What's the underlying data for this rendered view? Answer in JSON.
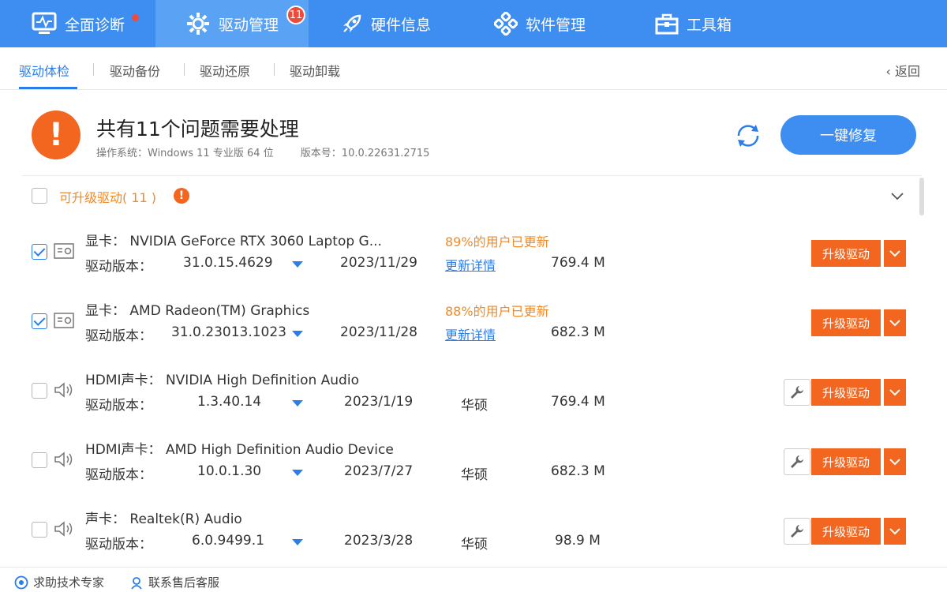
{
  "topnav": {
    "tabs": [
      {
        "label": "全面诊断",
        "icon": "monitor-pulse-icon"
      },
      {
        "label": "驱动管理",
        "icon": "gear-icon",
        "badge": "11"
      },
      {
        "label": "硬件信息",
        "icon": "rocket-icon"
      },
      {
        "label": "软件管理",
        "icon": "app-grid-icon"
      },
      {
        "label": "工具箱",
        "icon": "toolbox-icon"
      }
    ]
  },
  "subnav": {
    "tabs": [
      "驱动体检",
      "驱动备份",
      "驱动还原",
      "驱动卸载"
    ],
    "back": "返回"
  },
  "summary": {
    "title": "共有11个问题需要处理",
    "os": "操作系统：Windows 11 专业版 64 位",
    "version": "版本号：10.0.22631.2715",
    "fix_label": "一键修复"
  },
  "group": {
    "title": "可升级驱动( 11 )"
  },
  "rows": [
    {
      "name": "显卡： NVIDIA GeForce RTX 3060 Laptop G...",
      "ver_label": "驱动版本：",
      "version": "31.0.15.4629",
      "date": "2023/11/29",
      "hot": "89%的用户已更新",
      "detail": "更新详情",
      "size": "769.4 M",
      "btn": "升级驱动"
    },
    {
      "name": "显卡： AMD Radeon(TM) Graphics",
      "ver_label": "驱动版本：",
      "version": "31.0.23013.1023",
      "date": "2023/11/28",
      "hot": "88%的用户已更新",
      "detail": "更新详情",
      "size": "682.3 M",
      "btn": "升级驱动"
    },
    {
      "name": "HDMI声卡： NVIDIA High Definition Audio",
      "ver_label": "驱动版本：",
      "version": "1.3.40.14",
      "date": "2023/1/19",
      "vendor": "华硕",
      "size": "769.4 M",
      "btn": "升级驱动"
    },
    {
      "name": "HDMI声卡： AMD High Definition Audio Device",
      "ver_label": "驱动版本：",
      "version": "10.0.1.30",
      "date": "2023/7/27",
      "vendor": "华硕",
      "size": "682.3 M",
      "btn": "升级驱动"
    },
    {
      "name": "声卡： Realtek(R) Audio",
      "ver_label": "驱动版本：",
      "version": "6.0.9499.1",
      "date": "2023/3/28",
      "vendor": "华硕",
      "size": "98.9 M",
      "btn": "升级驱动"
    }
  ],
  "footer": {
    "help": "求助技术专家",
    "support": "联系售后客服"
  },
  "colors": {
    "primary": "#3d8ef0",
    "accent": "#f2661f",
    "warn_text": "#f08a2a",
    "link": "#2b7de9"
  }
}
